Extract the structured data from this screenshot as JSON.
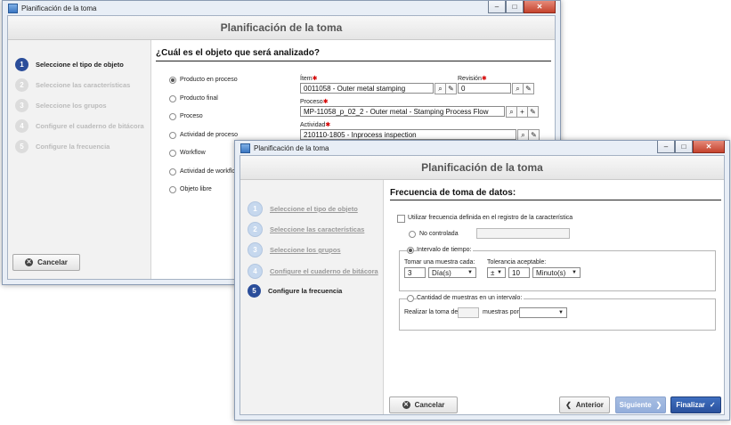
{
  "back_window": {
    "title": "Planificación de la toma",
    "header": "Planificación de la toma",
    "steps": [
      {
        "num": "1",
        "label": "Seleccione el tipo de objeto"
      },
      {
        "num": "2",
        "label": "Seleccione las características"
      },
      {
        "num": "3",
        "label": "Seleccione los grupos"
      },
      {
        "num": "4",
        "label": "Configure el cuaderno de bitácora"
      },
      {
        "num": "5",
        "label": "Configure la frecuencia"
      }
    ],
    "question": "¿Cuál es el objeto que será analizado?",
    "options": [
      "Producto en proceso",
      "Producto final",
      "Proceso",
      "Actividad de proceso",
      "Workflow",
      "Actividad de workflow",
      "Objeto libre"
    ],
    "item_label": "Ítem",
    "item_value": "0011058 - Outer metal stamping",
    "revision_label": "Revisión",
    "revision_value": "0",
    "process_label": "Proceso",
    "process_value": "MP-11058_p_02_2 - Outer metal - Stamping Process Flow",
    "activity_label": "Actividad",
    "activity_value": "210110-1805 - Inprocess inspection",
    "cancel": "Cancelar"
  },
  "front_window": {
    "title": "Planificación de la toma",
    "header": "Planificación de la toma",
    "steps": [
      {
        "num": "1",
        "label": "Seleccione el tipo de objeto"
      },
      {
        "num": "2",
        "label": "Seleccione las características"
      },
      {
        "num": "3",
        "label": "Seleccione los grupos"
      },
      {
        "num": "4",
        "label": "Configure el cuaderno de bitácora"
      },
      {
        "num": "5",
        "label": "Configure la frecuencia"
      }
    ],
    "section_title": "Frecuencia de toma de datos:",
    "use_freq_label": "Utilizar frecuencia definida en el registro de la característica",
    "no_controlada": "No controlada",
    "interval_label": "Intervalo de tiempo:",
    "tomar_label": "Tomar una muestra cada:",
    "tomar_value": "3",
    "tomar_unit": "Día(s)",
    "tol_label": "Tolerancia aceptable:",
    "tol_sign": "±",
    "tol_value": "10",
    "tol_unit": "Minuto(s)",
    "cantidad_label": "Cantidad de muestras en un intervalo:",
    "realizar_label": "Realizar la toma de",
    "muestras_label": "muestras por",
    "cancel": "Cancelar",
    "previous": "Anterior",
    "next": "Siguiente",
    "finish": "Finalizar"
  }
}
